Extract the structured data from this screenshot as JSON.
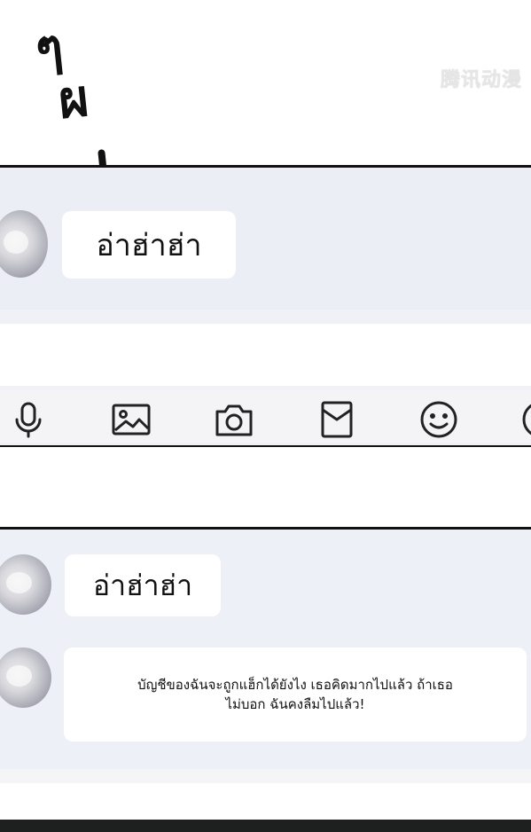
{
  "sfx": {
    "line1": "ๆ",
    "line2": "ผ"
  },
  "watermark": "腾讯动漫",
  "panel1": {
    "message": "อ่าฮ่าฮ่า",
    "icons": [
      "microphone-icon",
      "image-icon",
      "camera-icon",
      "red-envelope-icon",
      "emoji-icon",
      "add-icon"
    ]
  },
  "panel2": {
    "message1": "อ่าฮ่าฮ่า",
    "message2_line1": "บัญชีของฉันจะถูกแฮ็กได้ยังไง เธอคิดมากไปแล้ว ถ้าเธอ",
    "message2_line2": "ไม่บอก ฉันคงลืมไปแล้ว!"
  },
  "colors": {
    "panel_bg": "#eceef5",
    "bubble_bg": "#ffffff",
    "border": "#111111"
  }
}
